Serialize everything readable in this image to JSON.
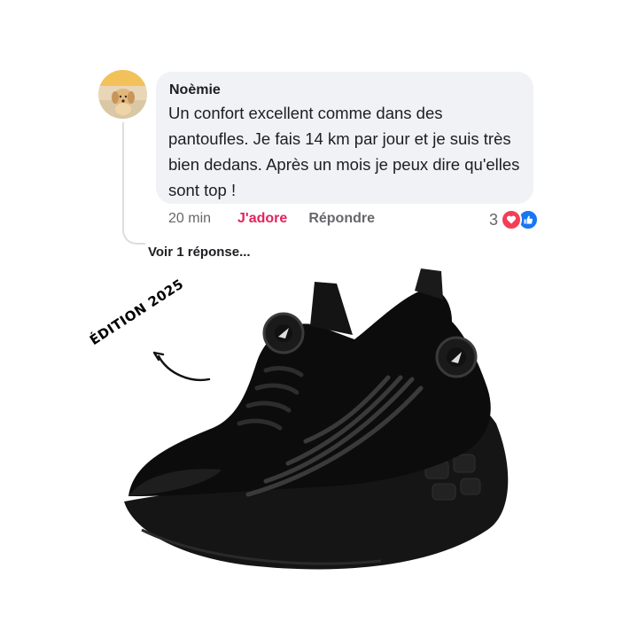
{
  "comment": {
    "author": "Noèmie",
    "text": "Un confort excellent comme dans des pantoufles. Je fais 14 km par jour et je suis très bien dedans. Après un mois je peux dire qu'elles sont top !",
    "time": "20 min",
    "like_label": "J'adore",
    "reply_label": "Répondre",
    "reaction_count": "3",
    "reaction_icons": [
      "heart-icon",
      "thumbs-up-icon"
    ],
    "view_replies": "Voir 1 réponse..."
  },
  "promo": {
    "badge": "ÉDITION 2025"
  },
  "colors": {
    "like": "#e0245e",
    "heart": "#f33e58",
    "thumb": "#1877f2",
    "bubble": "#f0f2f5"
  }
}
